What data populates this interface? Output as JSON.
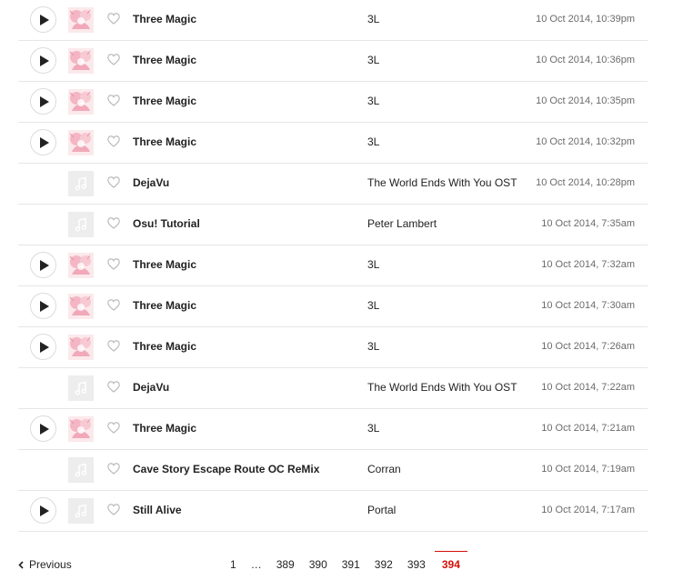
{
  "tracks": [
    {
      "has_play": true,
      "art": "cover",
      "title": "Three Magic",
      "artist": "3L",
      "timestamp": "10 Oct 2014, 10:39pm"
    },
    {
      "has_play": true,
      "art": "cover",
      "title": "Three Magic",
      "artist": "3L",
      "timestamp": "10 Oct 2014, 10:36pm"
    },
    {
      "has_play": true,
      "art": "cover",
      "title": "Three Magic",
      "artist": "3L",
      "timestamp": "10 Oct 2014, 10:35pm"
    },
    {
      "has_play": true,
      "art": "cover",
      "title": "Three Magic",
      "artist": "3L",
      "timestamp": "10 Oct 2014, 10:32pm"
    },
    {
      "has_play": false,
      "art": "placeholder",
      "title": "DejaVu",
      "artist": "The World Ends With You OST",
      "timestamp": "10 Oct 2014, 10:28pm"
    },
    {
      "has_play": false,
      "art": "placeholder",
      "title": "Osu! Tutorial",
      "artist": "Peter Lambert",
      "timestamp": "10 Oct 2014, 7:35am"
    },
    {
      "has_play": true,
      "art": "cover",
      "title": "Three Magic",
      "artist": "3L",
      "timestamp": "10 Oct 2014, 7:32am"
    },
    {
      "has_play": true,
      "art": "cover",
      "title": "Three Magic",
      "artist": "3L",
      "timestamp": "10 Oct 2014, 7:30am"
    },
    {
      "has_play": true,
      "art": "cover",
      "title": "Three Magic",
      "artist": "3L",
      "timestamp": "10 Oct 2014, 7:26am"
    },
    {
      "has_play": false,
      "art": "placeholder",
      "title": "DejaVu",
      "artist": "The World Ends With You OST",
      "timestamp": "10 Oct 2014, 7:22am"
    },
    {
      "has_play": true,
      "art": "cover",
      "title": "Three Magic",
      "artist": "3L",
      "timestamp": "10 Oct 2014, 7:21am"
    },
    {
      "has_play": false,
      "art": "placeholder",
      "title": "Cave Story Escape Route OC ReMix",
      "artist": "Corran",
      "timestamp": "10 Oct 2014, 7:19am"
    },
    {
      "has_play": true,
      "art": "placeholder",
      "title": "Still Alive",
      "artist": "Portal",
      "timestamp": "10 Oct 2014, 7:17am"
    }
  ],
  "pagination": {
    "previous_label": "Previous",
    "pages": [
      "1",
      "…",
      "389",
      "390",
      "391",
      "392",
      "393",
      "394"
    ],
    "current": "394"
  },
  "colors": {
    "accent": "#d51007",
    "divider": "#e6e6e6",
    "timestamp": "#6b6b6b",
    "cover_bg": "#fbe7ea"
  },
  "icons": {
    "play": "play-icon",
    "love": "heart-icon",
    "placeholder_art": "music-note-icon",
    "previous": "chevron-left-icon"
  }
}
